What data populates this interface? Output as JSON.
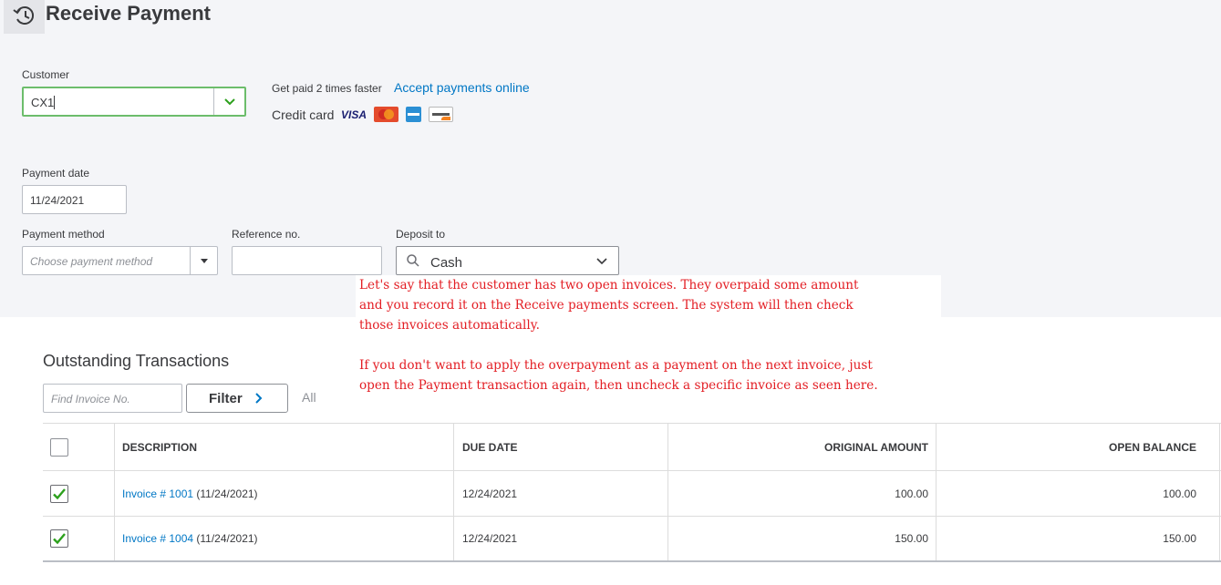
{
  "page": {
    "title": "Receive Payment"
  },
  "customer": {
    "label": "Customer",
    "value": "CX1"
  },
  "promo": {
    "text": "Get paid 2 times faster",
    "link": "Accept payments online",
    "credit_card_label": "Credit card",
    "visa_text": "VISA"
  },
  "payment_date": {
    "label": "Payment date",
    "value": "11/24/2021"
  },
  "payment_method": {
    "label": "Payment method",
    "placeholder": "Choose payment method"
  },
  "reference_no": {
    "label": "Reference no.",
    "value": ""
  },
  "deposit_to": {
    "label": "Deposit to",
    "value": "Cash"
  },
  "annotation": {
    "paragraph1_line1": "Let's say that the customer has two open invoices. They overpaid some amount",
    "paragraph1_line2": "and you record it on the Receive payments screen. The system will then check",
    "paragraph1_line3": "those invoices automatically.",
    "paragraph2_line1": "If you don't want to apply the overpayment as a payment on the next invoice, just",
    "paragraph2_line2": "open the Payment transaction again, then uncheck a specific invoice as seen here."
  },
  "outstanding": {
    "title": "Outstanding Transactions",
    "find_placeholder": "Find Invoice No.",
    "filter_label": "Filter",
    "all_label": "All",
    "columns": [
      "DESCRIPTION",
      "DUE DATE",
      "ORIGINAL AMOUNT",
      "OPEN BALANCE"
    ],
    "rows": [
      {
        "checked": true,
        "invoice_link": "Invoice # 1001",
        "invoice_date": " (11/24/2021)",
        "due_date": "12/24/2021",
        "original_amount": "100.00",
        "open_balance": "100.00"
      },
      {
        "checked": true,
        "invoice_link": "Invoice # 1004",
        "invoice_date": " (11/24/2021)",
        "due_date": "12/24/2021",
        "original_amount": "150.00",
        "open_balance": "150.00"
      }
    ]
  },
  "colors": {
    "accent_green": "#2ca01c",
    "link_blue": "#0077c5",
    "annotation_red": "#e31e24",
    "focus_border": "#6cbd6b"
  }
}
